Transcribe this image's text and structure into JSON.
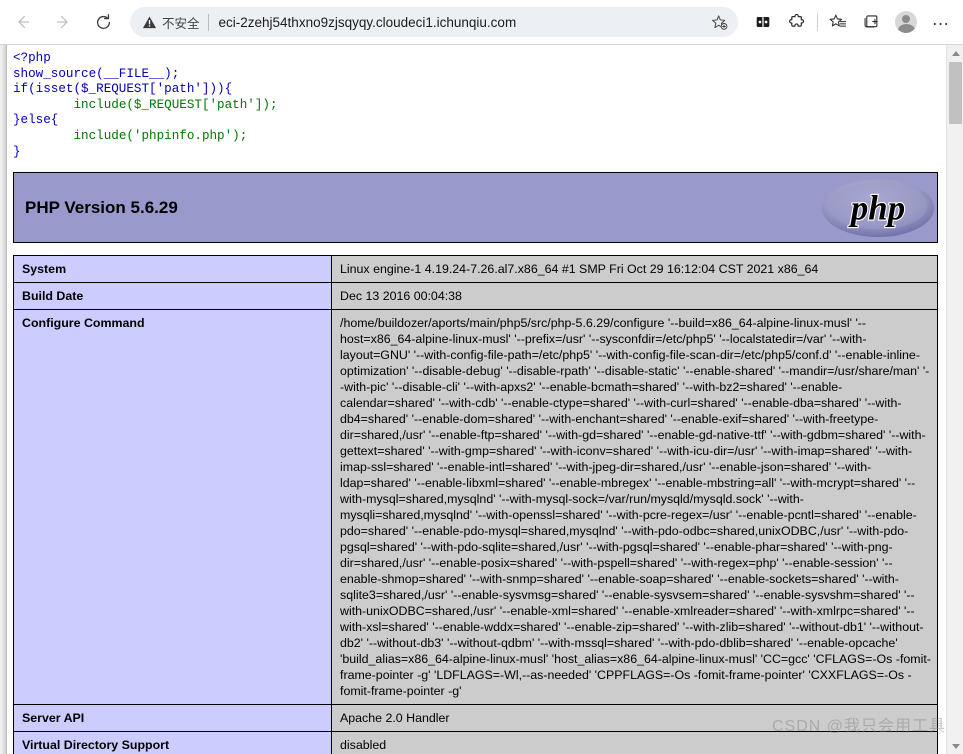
{
  "browser": {
    "back_tooltip": "Back",
    "forward_tooltip": "Forward",
    "reload_tooltip": "Refresh",
    "security_label": "不安全",
    "url": "eci-2zehj54thxno9zjsqyqy.cloudeci1.ichunqiu.com",
    "ellipsis_label": "…",
    "icons": {
      "back": "arrow-left-icon",
      "forward": "arrow-right-icon",
      "reload": "reload-icon",
      "security": "warning-triangle-icon",
      "favorite": "star-add-icon",
      "split_screen": "split-screen-icon",
      "extensions": "puzzle-piece-icon",
      "favorites_bar": "favorites-star-list-icon",
      "collections": "collections-icon",
      "profile": "profile-avatar-icon",
      "settings_menu": "ellipsis-icon"
    }
  },
  "source_code": {
    "line1_open": "<?php",
    "line2": "show_source(__FILE__);",
    "line3": "if(isset($_REQUEST['path'])){",
    "line4": "include($_REQUEST['path']);",
    "line5": "}else{",
    "line6": "include('phpinfo.php');",
    "line7": "}",
    "tokens": {
      "php_open": "<?php",
      "show_source": "show_source",
      "file_const": "__FILE__",
      "if": "if",
      "isset": "isset",
      "request": "$_REQUEST",
      "path_str": "'path'",
      "include": "include",
      "else": "}else{",
      "phpinfo_str": "'phpinfo.php'"
    }
  },
  "phpinfo": {
    "version_title": "PHP Version 5.6.29",
    "logo_text": "php",
    "rows": [
      {
        "key": "System",
        "value": "Linux engine-1 4.19.24-7.26.al7.x86_64 #1 SMP Fri Oct 29 16:12:04 CST 2021 x86_64"
      },
      {
        "key": "Build Date",
        "value": "Dec 13 2016 00:04:38"
      },
      {
        "key": "Configure Command",
        "value": "/home/buildozer/aports/main/php5/src/php-5.6.29/configure '--build=x86_64-alpine-linux-musl' '--host=x86_64-alpine-linux-musl' '--prefix=/usr' '--sysconfdir=/etc/php5' '--localstatedir=/var' '--with-layout=GNU' '--with-config-file-path=/etc/php5' '--with-config-file-scan-dir=/etc/php5/conf.d' '--enable-inline-optimization' '--disable-debug' '--disable-rpath' '--disable-static' '--enable-shared' '--mandir=/usr/share/man' '--with-pic' '--disable-cli' '--with-apxs2' '--enable-bcmath=shared' '--with-bz2=shared' '--enable-calendar=shared' '--with-cdb' '--enable-ctype=shared' '--with-curl=shared' '--enable-dba=shared' '--with-db4=shared' '--enable-dom=shared' '--with-enchant=shared' '--enable-exif=shared' '--with-freetype-dir=shared,/usr' '--enable-ftp=shared' '--with-gd=shared' '--enable-gd-native-ttf' '--with-gdbm=shared' '--with-gettext=shared' '--with-gmp=shared' '--with-iconv=shared' '--with-icu-dir=/usr' '--with-imap=shared' '--with-imap-ssl=shared' '--enable-intl=shared' '--with-jpeg-dir=shared,/usr' '--enable-json=shared' '--with-ldap=shared' '--enable-libxml=shared' '--enable-mbregex' '--enable-mbstring=all' '--with-mcrypt=shared' '--with-mysql=shared,mysqlnd' '--with-mysql-sock=/var/run/mysqld/mysqld.sock' '--with-mysqli=shared,mysqlnd' '--with-openssl=shared' '--with-pcre-regex=/usr' '--enable-pcntl=shared' '--enable-pdo=shared' '--enable-pdo-mysql=shared,mysqlnd' '--with-pdo-odbc=shared,unixODBC,/usr' '--with-pdo-pgsql=shared' '--with-pdo-sqlite=shared,/usr' '--with-pgsql=shared' '--enable-phar=shared' '--with-png-dir=shared,/usr' '--enable-posix=shared' '--with-pspell=shared' '--with-regex=php' '--enable-session' '--enable-shmop=shared' '--with-snmp=shared' '--enable-soap=shared' '--enable-sockets=shared' '--with-sqlite3=shared,/usr' '--enable-sysvmsg=shared' '--enable-sysvsem=shared' '--enable-sysvshm=shared' '--with-unixODBC=shared,/usr' '--enable-xml=shared' '--enable-xmlreader=shared' '--with-xmlrpc=shared' '--with-xsl=shared' '--enable-wddx=shared' '--enable-zip=shared' '--with-zlib=shared' '--without-db1' '--without-db2' '--without-db3' '--without-qdbm' '--with-mssql=shared' '--with-pdo-dblib=shared' '--enable-opcache' 'build_alias=x86_64-alpine-linux-musl' 'host_alias=x86_64-alpine-linux-musl' 'CC=gcc' 'CFLAGS=-Os -fomit-frame-pointer -g' 'LDFLAGS=-Wl,--as-needed' 'CPPFLAGS=-Os -fomit-frame-pointer' 'CXXFLAGS=-Os -fomit-frame-pointer -g'"
      },
      {
        "key": "Server API",
        "value": "Apache 2.0 Handler"
      },
      {
        "key": "Virtual Directory Support",
        "value": "disabled"
      }
    ]
  },
  "watermark": {
    "text": "CSDN @我只会用工具"
  },
  "colors": {
    "php_header_bg": "#9999cc",
    "key_cell_bg": "#ccccff",
    "value_cell_bg": "#cccccc",
    "omnibox_bg": "#eceff3"
  }
}
